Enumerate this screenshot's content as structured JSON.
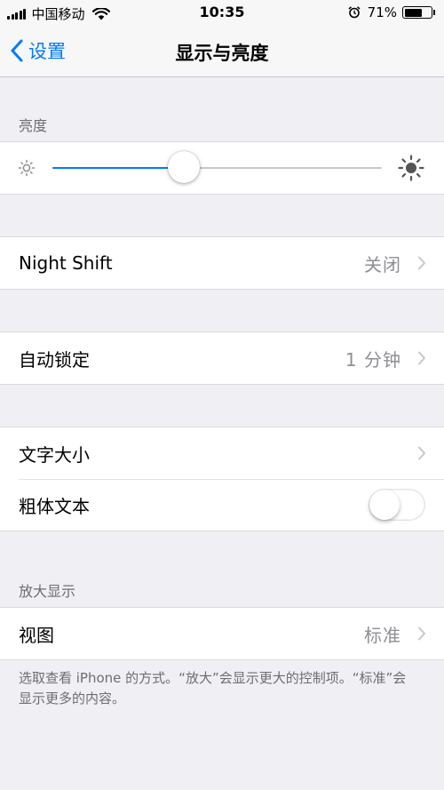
{
  "status_bar": {
    "carrier": "中国移动",
    "time": "10:35",
    "battery_percent": "71%",
    "battery_level": 0.71
  },
  "nav": {
    "back_label": "设置",
    "title": "显示与亮度"
  },
  "brightness": {
    "header": "亮度",
    "level": 0.4
  },
  "night_shift": {
    "label": "Night Shift",
    "value": "关闭"
  },
  "auto_lock": {
    "label": "自动锁定",
    "value": "1 分钟"
  },
  "text": {
    "text_size_label": "文字大小",
    "bold_text_label": "粗体文本",
    "bold_text_on": false
  },
  "zoom": {
    "header": "放大显示",
    "view_label": "视图",
    "view_value": "标准",
    "footnote": "选取查看 iPhone 的方式。“放大”会显示更大的控制项。“标准”会显示更多的内容。"
  },
  "colors": {
    "accent": "#007aff",
    "background": "#efeff4"
  }
}
